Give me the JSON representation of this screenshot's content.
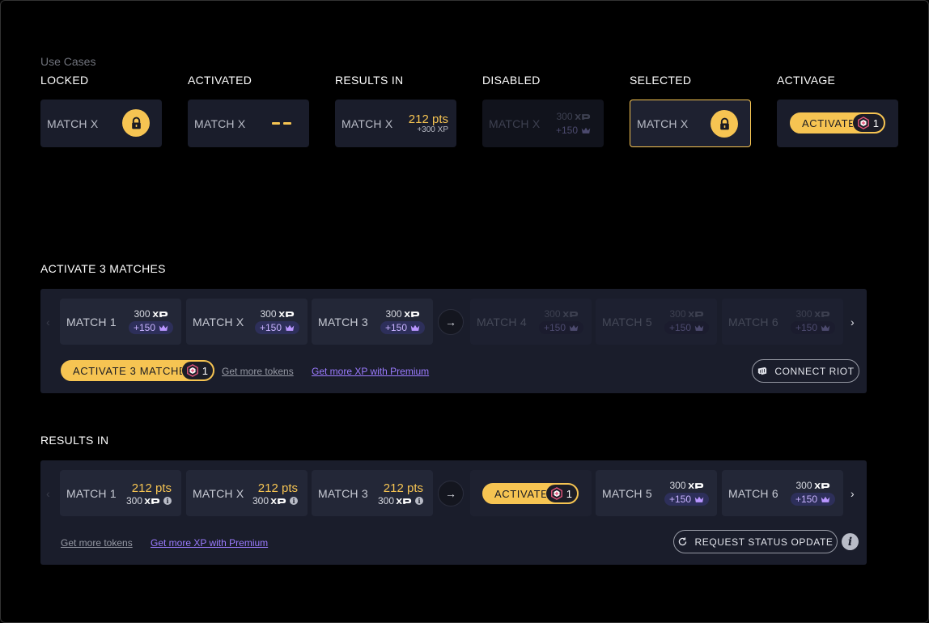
{
  "use_cases": {
    "heading": "Use Cases",
    "columns": [
      {
        "label": "LOCKED",
        "match": "MATCH X"
      },
      {
        "label": "ACTIVATED",
        "match": "MATCH X"
      },
      {
        "label": "RESULTS IN",
        "match": "MATCH X",
        "points": "212 pts",
        "xp": "+300 XP"
      },
      {
        "label": "DISABLED",
        "match": "MATCH X",
        "xp": "300",
        "bonus": "+150"
      },
      {
        "label": "SELECTED",
        "match": "MATCH X"
      },
      {
        "label": "ACTIVAGE",
        "activate_label": "ACTIVATE",
        "tokens": "1"
      }
    ]
  },
  "activate_section": {
    "title": "ACTIVATE 3 MATCHES",
    "matches": [
      {
        "name": "MATCH 1",
        "xp": "300",
        "bonus": "+150"
      },
      {
        "name": "MATCH X",
        "xp": "300",
        "bonus": "+150"
      },
      {
        "name": "MATCH 3",
        "xp": "300",
        "bonus": "+150"
      },
      {
        "name": "MATCH 4",
        "xp": "300",
        "bonus": "+150"
      },
      {
        "name": "MATCH 5",
        "xp": "300",
        "bonus": "+150"
      },
      {
        "name": "MATCH 6",
        "xp": "300",
        "bonus": "+150"
      }
    ],
    "arrow": "→",
    "activate_button": "ACTIVATE 3 MATCHES",
    "tokens": "1",
    "link_tokens": "Get more tokens",
    "link_premium": "Get more XP with Premium",
    "connect_button": "CONNECT RIOT"
  },
  "results_section": {
    "title": "RESULTS IN",
    "matches": [
      {
        "name": "MATCH 1",
        "points": "212 pts",
        "xp": "300"
      },
      {
        "name": "MATCH X",
        "points": "212 pts",
        "xp": "300"
      },
      {
        "name": "MATCH 3",
        "points": "212 pts",
        "xp": "300"
      },
      {
        "name": "MATCH 5",
        "xp": "300",
        "bonus": "+150"
      },
      {
        "name": "MATCH 6",
        "xp": "300",
        "bonus": "+150"
      }
    ],
    "arrow": "→",
    "activate_label": "ACTIVATE",
    "tokens": "1",
    "link_tokens": "Get more tokens",
    "link_premium": "Get more XP with Premium",
    "status_button": "REQUEST STATUS OPDATE"
  },
  "icons": {
    "lock": "lock-icon",
    "xp": "xp-logo-icon",
    "crown": "crown-icon",
    "token": "hex-token-icon",
    "riot": "riot-fist-icon",
    "refresh": "refresh-icon",
    "info": "info-icon",
    "chevron_left": "chevron-left-icon",
    "chevron_right": "chevron-right-icon"
  },
  "colors": {
    "accent": "#f6c452",
    "premium": "#9b7bff",
    "panel": "#1a1d2b",
    "card": "#232737"
  }
}
